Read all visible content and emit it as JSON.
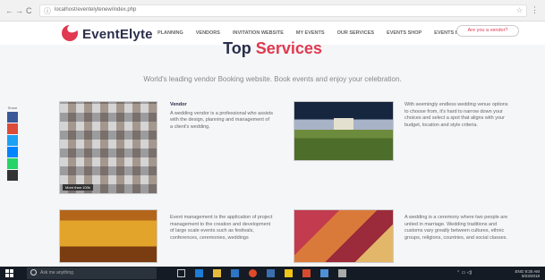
{
  "browser": {
    "back": "←",
    "forward": "→",
    "reload": "C",
    "url": "localhost/eventelytenew/index.php",
    "menu": "⋮"
  },
  "site": {
    "brand": "EventElyte",
    "nav": [
      "PLANNING",
      "VENDORS",
      "INVITATION WEBSITE",
      "MY EVENTS",
      "OUR SERVICES",
      "EVENTS SHOP",
      "EVENTS IDEAS"
    ],
    "vendor_button": "Are you a vendor?",
    "brand_color": "#e03950"
  },
  "section": {
    "title_a": "Top",
    "title_b": "Services",
    "subtitle": "World's leading vendor Booking website. Book events and enjoy your celebration."
  },
  "services": [
    {
      "heading": "Vendor",
      "text": "A wedding vendor is a professional who assists with the design, planning and management of a client's wedding.",
      "image_caption": "More than 100k"
    },
    {
      "heading": "",
      "text": "With seemingly endless wedding venue options to choose from, it's hard to narrow down your choices and select a spot that aligns with your budget, location and style criteria."
    },
    {
      "heading": "",
      "text": "Event management is the application of project management to the creation and development of large scale events such as festivals, conferences, ceremonies, weddings"
    },
    {
      "heading": "",
      "text": "A wedding is a ceremony where two people are united in marriage. Wedding traditions and customs vary greatly between cultures, ethnic groups, religions, countries, and social classes."
    }
  ],
  "share": {
    "label": "Share",
    "colors": [
      "#3b5998",
      "#dd4b39",
      "#1da1f2",
      "#0084ff",
      "#25d366",
      "#333333"
    ]
  },
  "taskbar": {
    "search_placeholder": "Ask me anything",
    "tray": "ENG",
    "time": "9:30 AM",
    "date": "9/23/2018"
  }
}
